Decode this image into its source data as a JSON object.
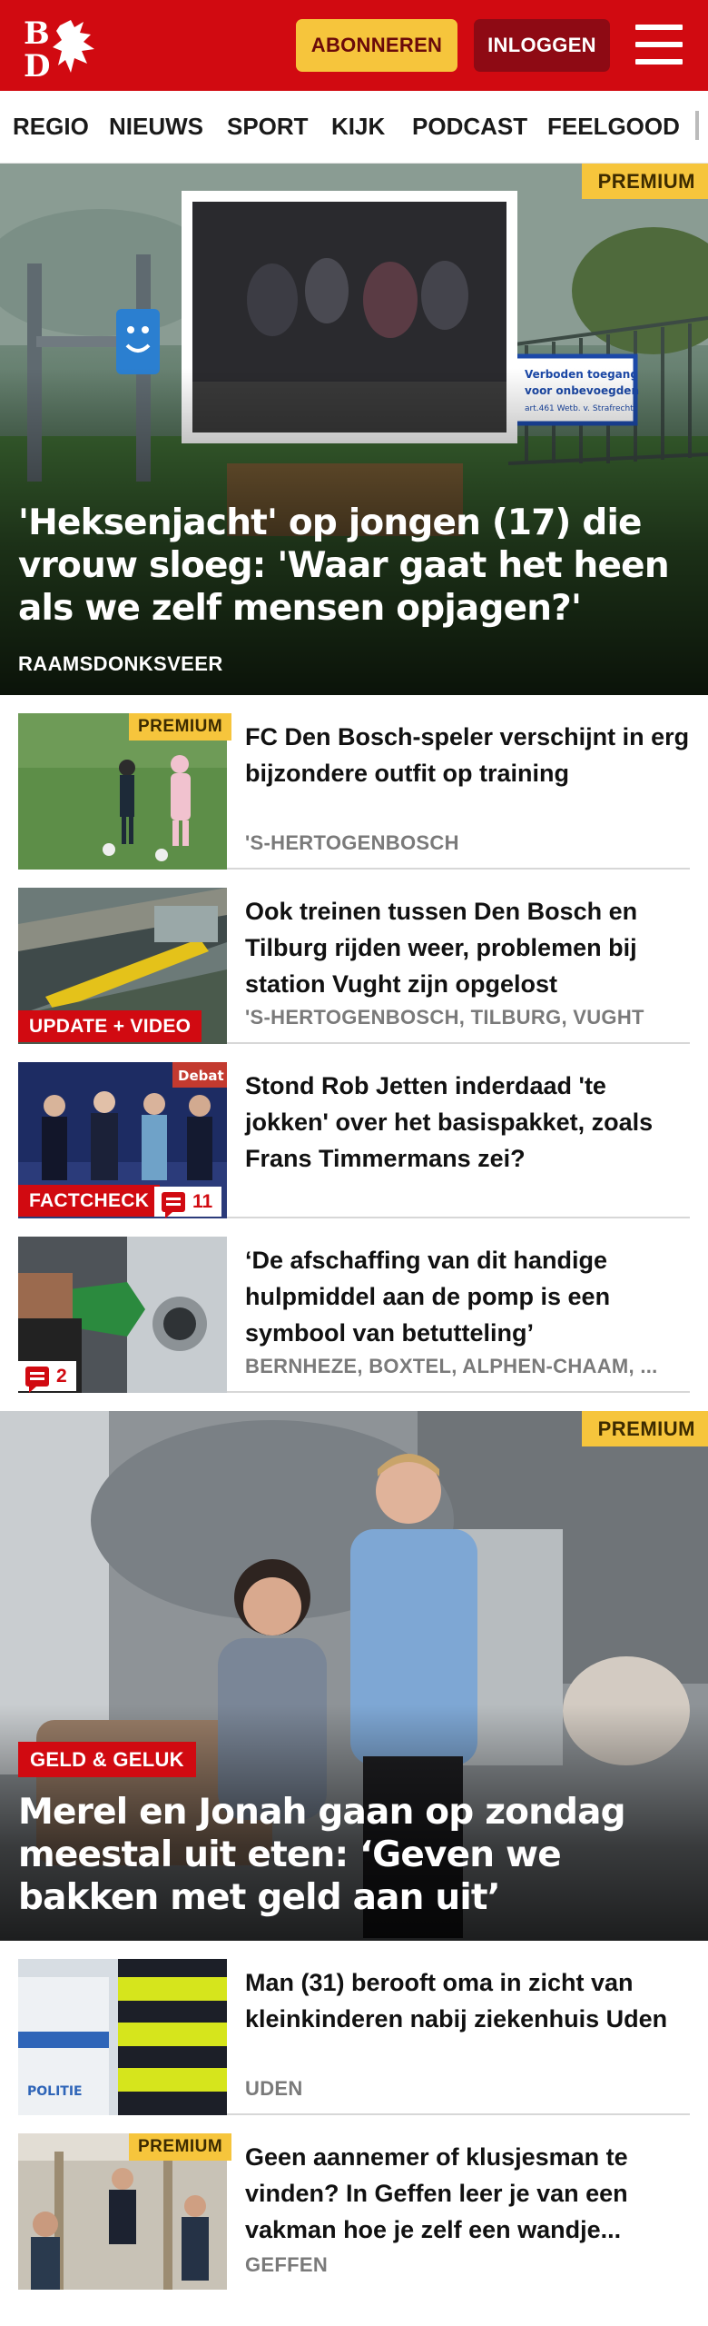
{
  "header": {
    "logo_text": "BD",
    "subscribe_label": "ABONNEREN",
    "login_label": "INLOGGEN"
  },
  "nav": {
    "items": [
      "REGIO",
      "NIEUWS",
      "SPORT",
      "KIJK",
      "PODCAST",
      "FEELGOOD"
    ]
  },
  "hero": {
    "badge": "PREMIUM",
    "title": "'Heksenjacht' op jongen (17) die vrouw sloeg: 'Waar gaat het heen als we zelf mensen opjagen?'",
    "location": "RAAMSDONKSVEER",
    "sign_text": "Verboden toegang voor onbevoegden art.461 Wetb. v. Strafrecht"
  },
  "articles": [
    {
      "badge": "PREMIUM",
      "title": "FC Den Bosch-speler verschijnt in erg bijzondere outfit op training",
      "location": "'S-HERTOGENBOSCH"
    },
    {
      "label": "UPDATE + VIDEO",
      "title": "Ook treinen tussen Den Bosch en Tilburg rijden weer, problemen bij station Vught zijn opgelost",
      "location": "'S-HERTOGENBOSCH, TILBURG, VUGHT"
    },
    {
      "label": "FACTCHECK",
      "comments": "11",
      "thumb_text": "Debat",
      "title": "Stond Rob Jetten inderdaad 'te jokken' over het basispakket, zoals Frans Timmermans zei?",
      "location": ""
    },
    {
      "comments": "2",
      "title": "‘De afschaffing van dit handige hulpmiddel aan de pomp is een symbool van betutteling’",
      "location": "BERNHEZE, BOXTEL, ALPHEN-CHAAM, ..."
    }
  ],
  "feature": {
    "badge": "PREMIUM",
    "category": "GELD & GELUK",
    "title": "Merel en Jonah gaan op zondag meestal uit eten: ‘Geven we bakken met geld aan uit’"
  },
  "articles2": [
    {
      "title": "Man (31) berooft oma in zicht van kleinkinderen nabij ziekenhuis Uden",
      "location": "UDEN",
      "thumb_text": "POLITIE"
    },
    {
      "badge": "PREMIUM",
      "title": "Geen aannemer of klusjesman te vinden? In Geffen leer je van een vakman hoe je zelf een wandje...",
      "location": "GEFFEN"
    }
  ],
  "colors": {
    "brand_red": "#d10a11",
    "premium_yellow": "#f6c53c",
    "login_dark_red": "#8e0a14"
  }
}
